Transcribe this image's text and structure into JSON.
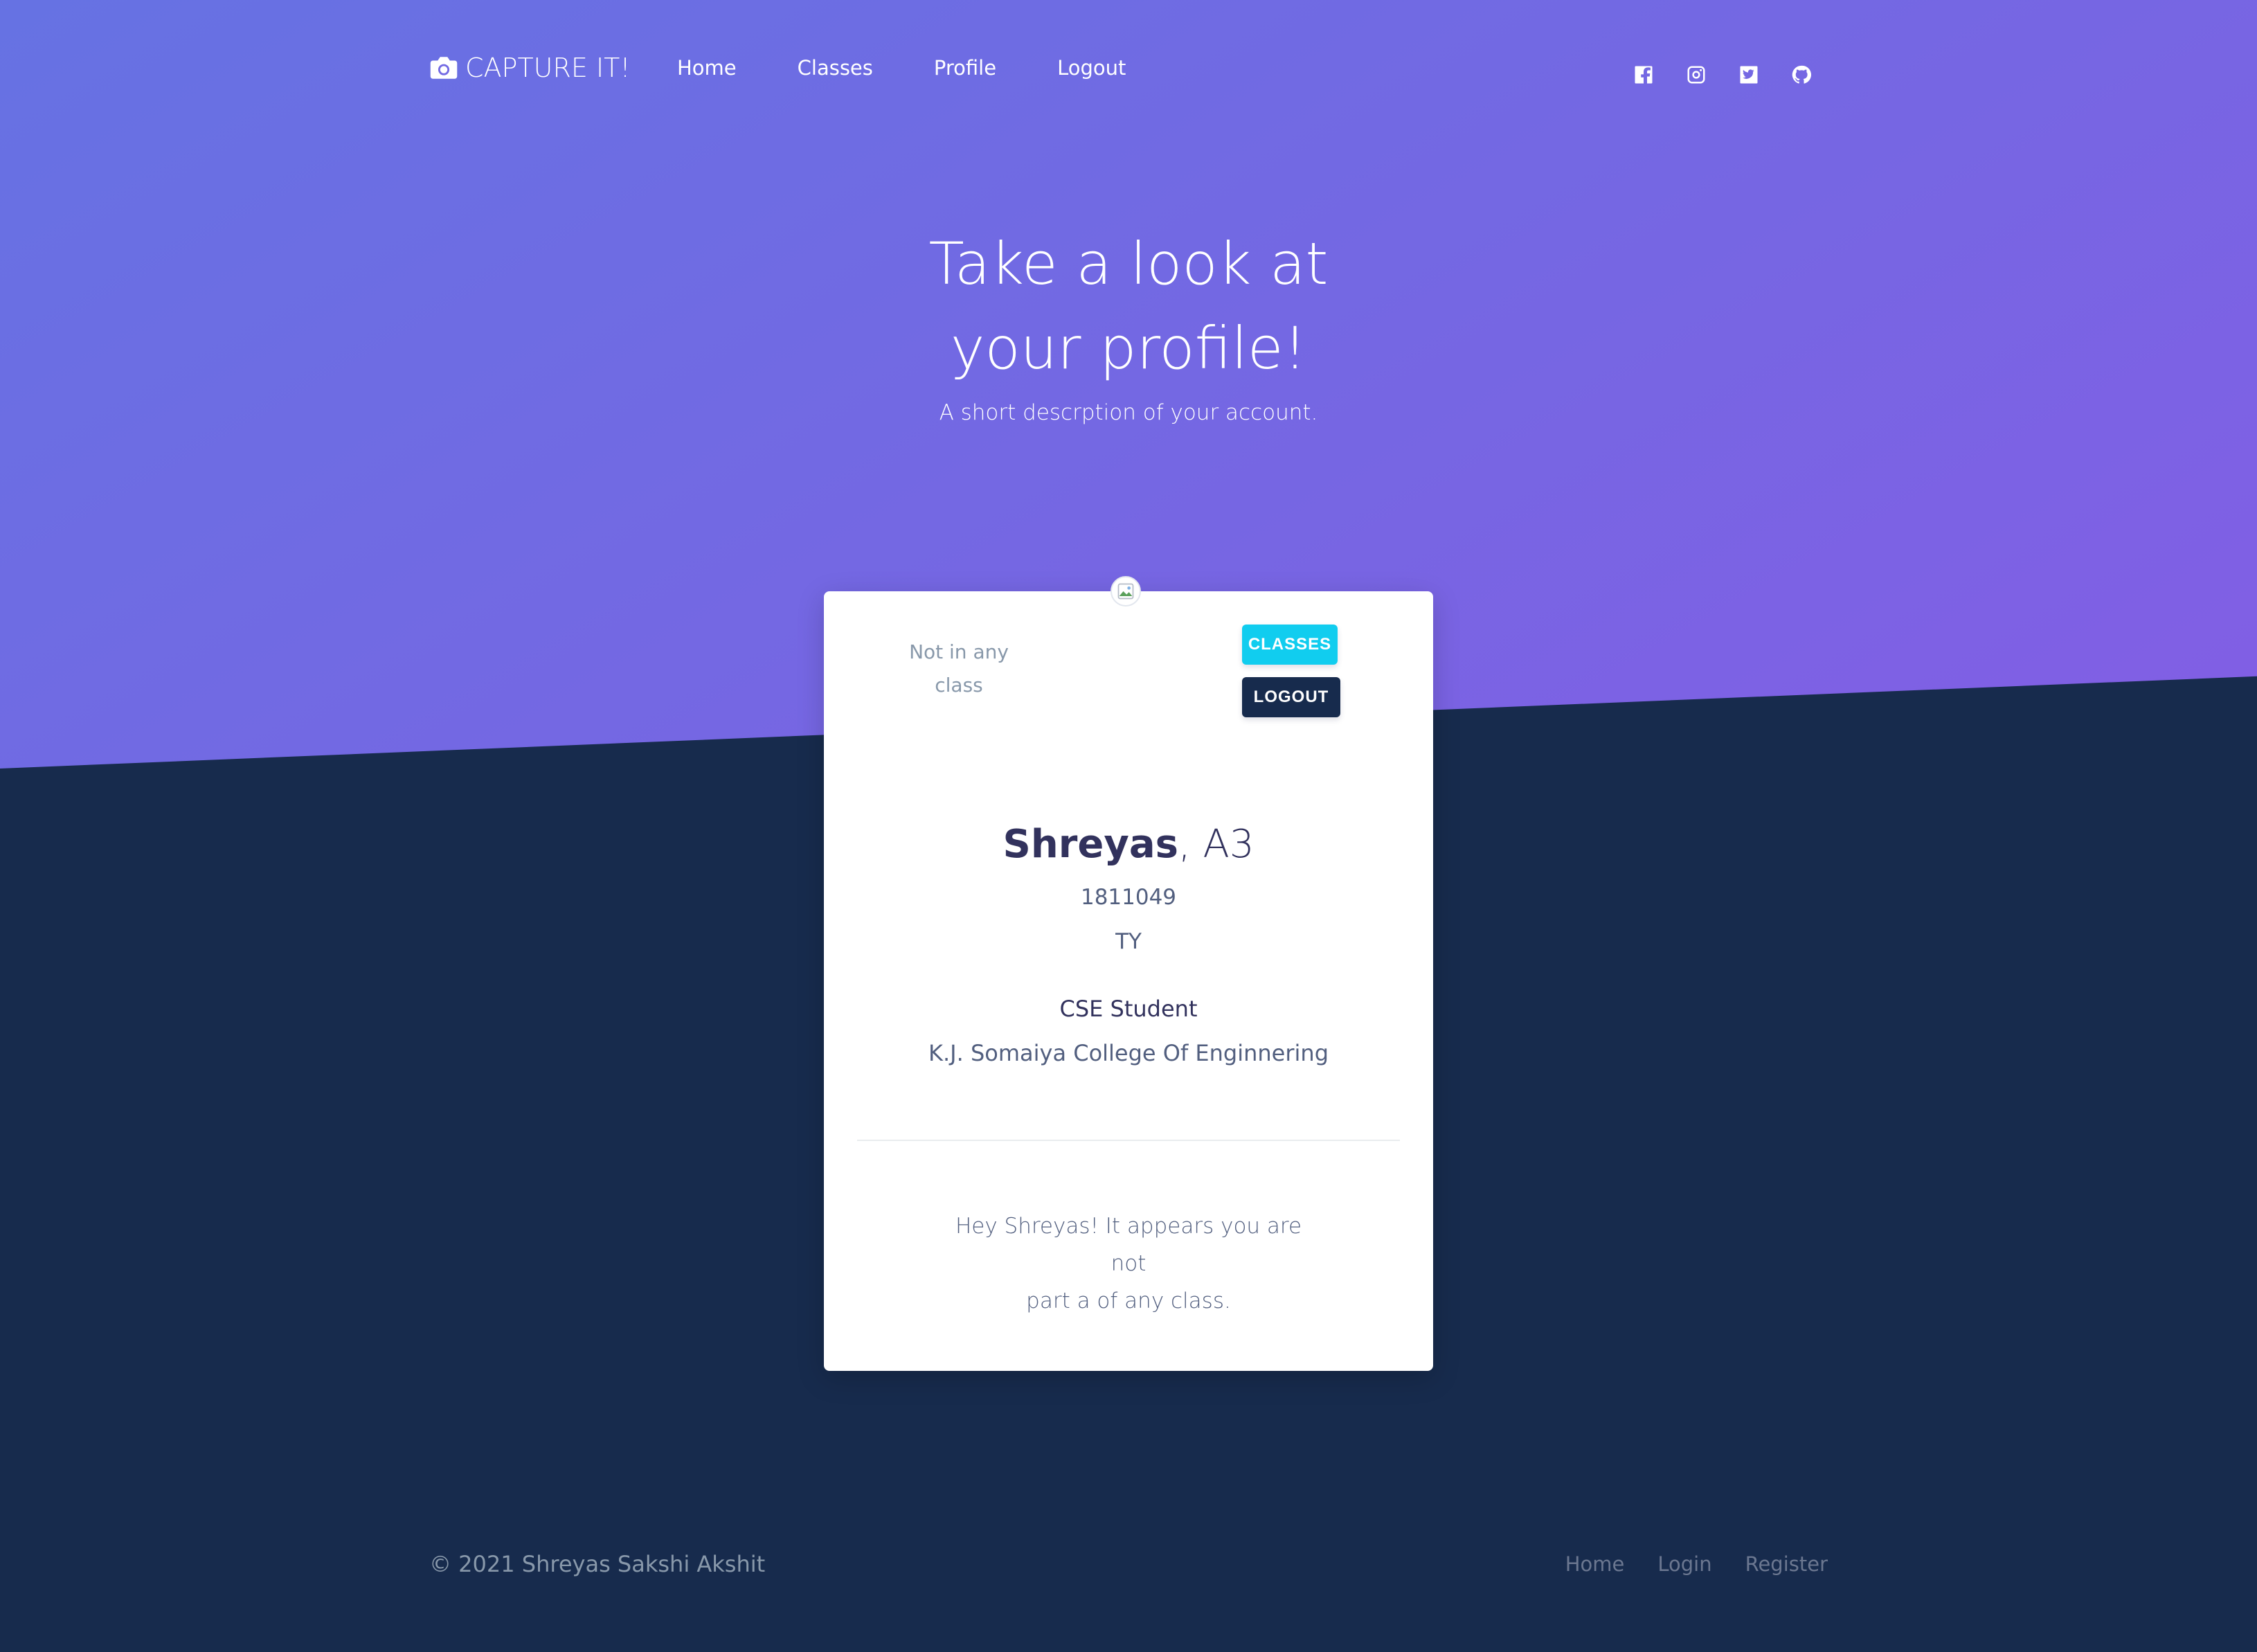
{
  "navbar": {
    "brand": "CAPTURE IT!",
    "links": [
      "Home",
      "Classes",
      "Profile",
      "Logout"
    ],
    "social": [
      "facebook-icon",
      "instagram-icon",
      "twitter-icon",
      "github-icon"
    ]
  },
  "hero": {
    "title_line1": "Take a look at",
    "title_line2": "your profile!",
    "subtitle": "A short descrption of your account."
  },
  "card": {
    "class_status_line1": "Not in any",
    "class_status_line2": "class",
    "classes_button": "CLASSES",
    "logout_button": "LOGOUT",
    "name": "Shreyas",
    "division": ", A3",
    "roll_number": "1811049",
    "year": "TY",
    "role": "CSE Student",
    "college": "K.J. Somaiya College Of Enginnering",
    "message_line1": "Hey Shreyas! It appears you are not",
    "message_line2": "part a of any class."
  },
  "footer": {
    "copyright": "© 2021 Shreyas Sakshi Akshit",
    "links": [
      "Home",
      "Login",
      "Register"
    ]
  },
  "colors": {
    "hero_gradient_start": "#6672e3",
    "hero_gradient_end": "#825ee4",
    "page_background": "#172b4d",
    "info_button": "#11cdef",
    "dark_button": "#172b4d"
  }
}
